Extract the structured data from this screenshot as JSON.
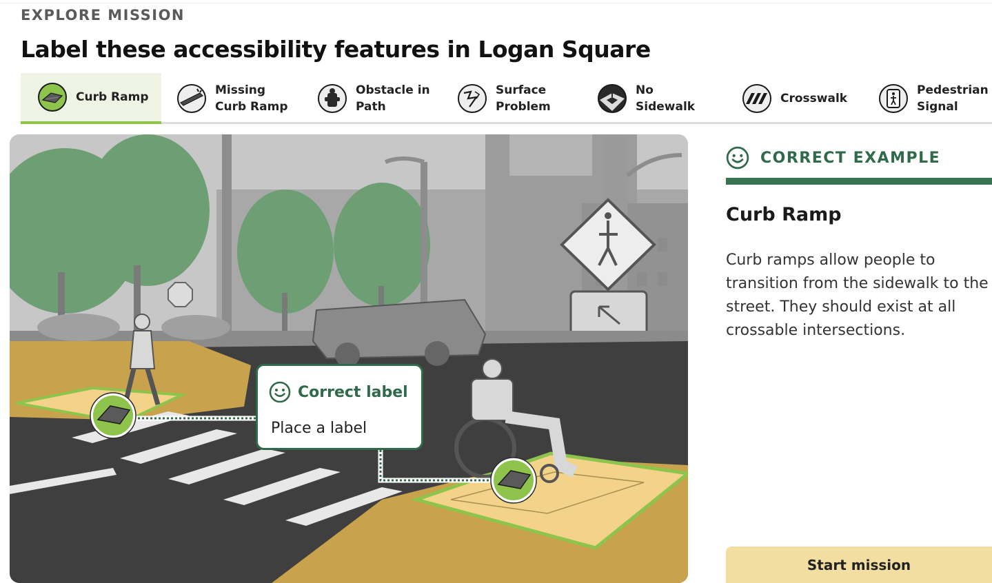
{
  "header": {
    "eyebrow": "EXPLORE MISSION",
    "title": "Label these accessibility features in Logan Square"
  },
  "tabs": [
    {
      "label": "Curb Ramp",
      "icon": "curb-ramp-icon",
      "active": true
    },
    {
      "label": "Missing\nCurb Ramp",
      "icon": "missing-curb-ramp-icon",
      "active": false
    },
    {
      "label": "Obstacle in\nPath",
      "icon": "fire-hydrant-icon",
      "active": false
    },
    {
      "label": "Surface\nProblem",
      "icon": "surface-problem-icon",
      "active": false
    },
    {
      "label": "No\nSidewalk",
      "icon": "no-sidewalk-icon",
      "active": false
    },
    {
      "label": "Crosswalk",
      "icon": "crosswalk-icon",
      "active": false
    },
    {
      "label": "Pedestrian\nSignal",
      "icon": "pedestrian-signal-icon",
      "active": false
    }
  ],
  "callout": {
    "heading": "Correct label",
    "body": "Place a label",
    "icon": "smiley-icon"
  },
  "panel": {
    "heading": "CORRECT EXAMPLE",
    "heading_icon": "smiley-icon",
    "feature_title": "Curb Ramp",
    "description": "Curb ramps allow people to transition from the sidewalk to the street. They should exist at all crossable intersections."
  },
  "actions": {
    "start_label": "Start mission"
  },
  "colors": {
    "accent_green": "#2f6b4b",
    "tab_underline": "#8ec44c",
    "active_tab_bg": "#eef3e4",
    "button_bg": "#f1dea0",
    "sidewalk_tan": "#c9a24e",
    "highlight_green": "#8ec44c"
  }
}
